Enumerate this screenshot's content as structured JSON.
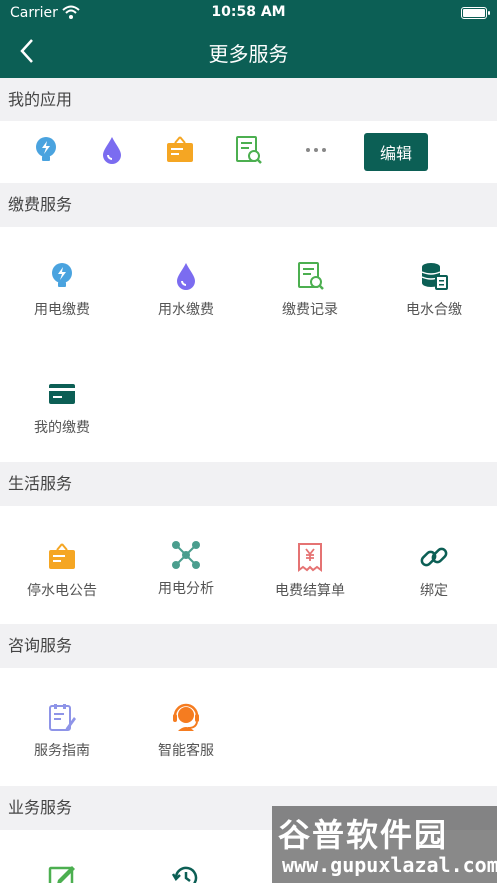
{
  "status_bar": {
    "carrier": "Carrier",
    "time": "10:58 AM"
  },
  "header": {
    "title": "更多服务"
  },
  "my_apps": {
    "heading": "我的应用",
    "icons": [
      "bulb-icon",
      "water-drop-icon",
      "notice-board-icon",
      "record-search-icon",
      "more-dots-icon"
    ],
    "edit_label": "编辑"
  },
  "sections": [
    {
      "heading": "缴费服务",
      "items": [
        {
          "label": "用电缴费",
          "icon": "bulb-icon"
        },
        {
          "label": "用水缴费",
          "icon": "water-drop-icon"
        },
        {
          "label": "缴费记录",
          "icon": "record-search-icon"
        },
        {
          "label": "电水合缴",
          "icon": "coins-icon"
        },
        {
          "label": "我的缴费",
          "icon": "card-icon"
        }
      ]
    },
    {
      "heading": "生活服务",
      "items": [
        {
          "label": "停水电公告",
          "icon": "notice-board-icon"
        },
        {
          "label": "用电分析",
          "icon": "network-icon"
        },
        {
          "label": "电费结算单",
          "icon": "receipt-icon"
        },
        {
          "label": "绑定",
          "icon": "link-icon"
        }
      ]
    },
    {
      "heading": "咨询服务",
      "items": [
        {
          "label": "服务指南",
          "icon": "guide-icon"
        },
        {
          "label": "智能客服",
          "icon": "headset-icon"
        }
      ]
    },
    {
      "heading": "业务服务",
      "items": []
    }
  ],
  "watermark": {
    "name": "谷普软件园",
    "url": "www.gupuxlazal.com"
  },
  "colors": {
    "brand": "#0c5f55",
    "blue": "#4aa3df",
    "purple": "#7b6cf0",
    "orange": "#f5a623",
    "green": "#4caf50"
  }
}
